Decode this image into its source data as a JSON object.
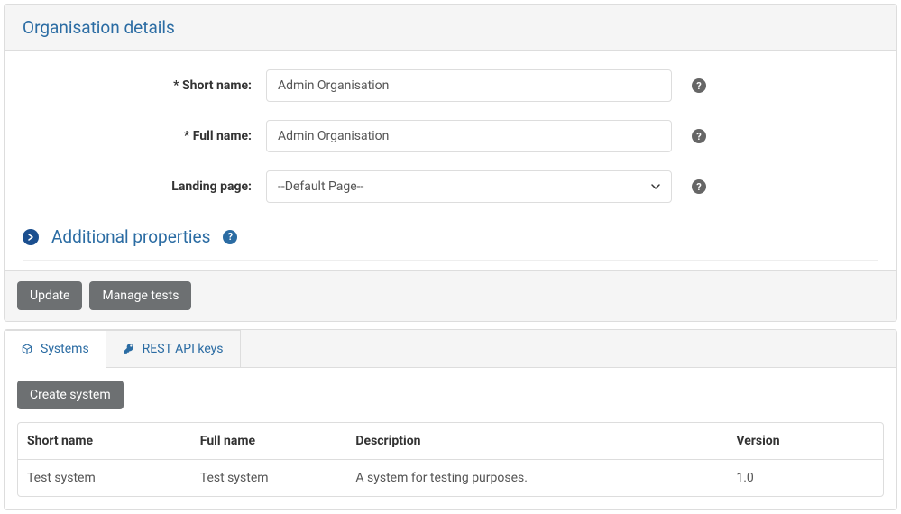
{
  "panel": {
    "title": "Organisation details",
    "fields": {
      "short_name": {
        "label": "* Short name:",
        "value": "Admin Organisation"
      },
      "full_name": {
        "label": "* Full name:",
        "value": "Admin Organisation"
      },
      "landing_page": {
        "label": "Landing page:",
        "value": "--Default Page--"
      }
    },
    "collapsible": {
      "title": "Additional properties"
    },
    "buttons": {
      "update": "Update",
      "manage_tests": "Manage tests"
    }
  },
  "tabs": {
    "systems": {
      "label": "Systems"
    },
    "rest_api": {
      "label": "REST API keys"
    }
  },
  "systems_tab": {
    "create_button": "Create system",
    "columns": {
      "short_name": "Short name",
      "full_name": "Full name",
      "description": "Description",
      "version": "Version"
    },
    "rows": [
      {
        "short_name": "Test system",
        "full_name": "Test system",
        "description": "A system for testing purposes.",
        "version": "1.0"
      }
    ]
  }
}
